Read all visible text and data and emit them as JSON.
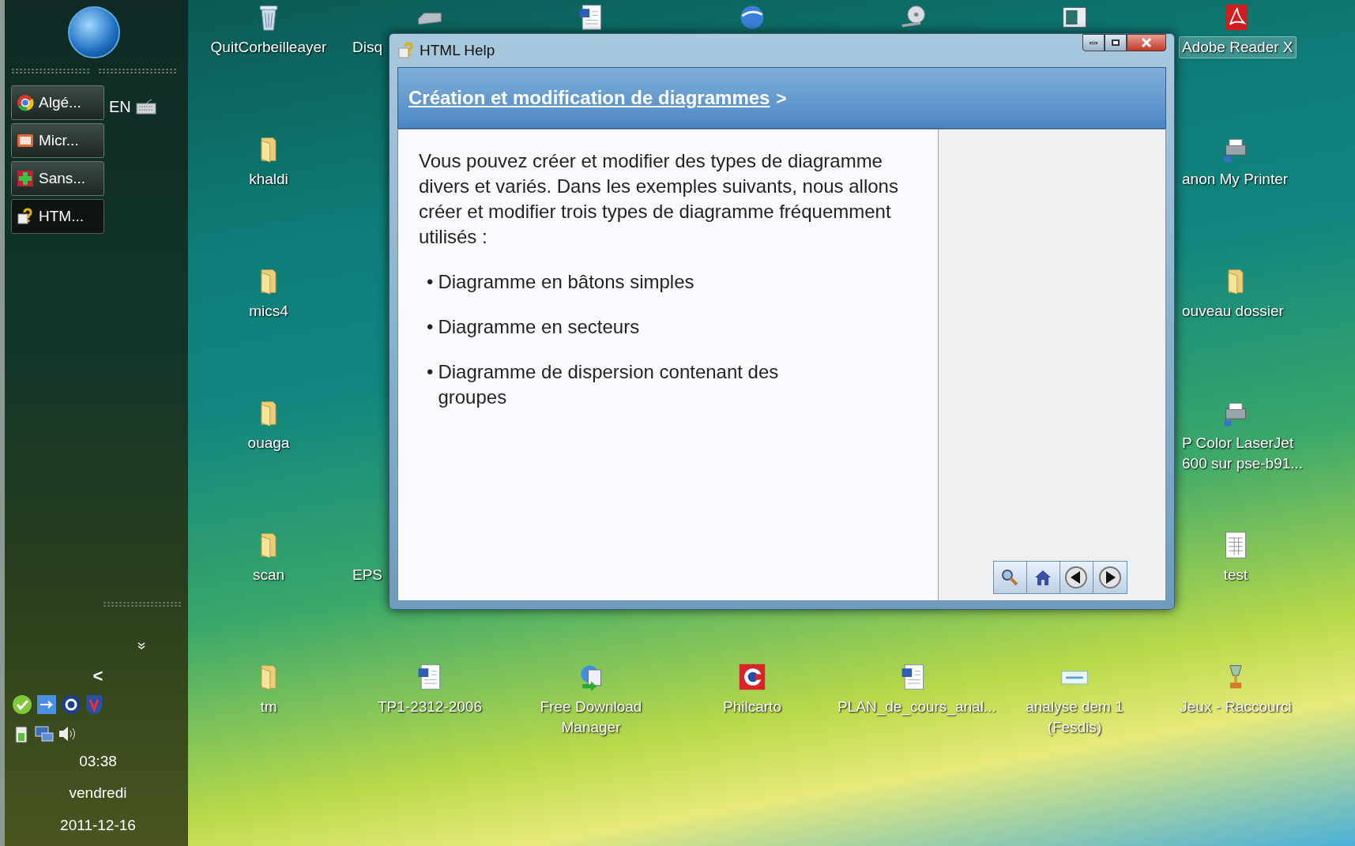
{
  "taskbar": {
    "tasks": [
      {
        "label": "Algé...",
        "kind": "chrome",
        "selected": false
      },
      {
        "label": "Micr...",
        "kind": "slides",
        "selected": false
      },
      {
        "label": "Sans...",
        "kind": "paint",
        "selected": false
      },
      {
        "label": "HTM...",
        "kind": "help",
        "selected": true
      }
    ],
    "language": "EN",
    "tray_arrow": "<",
    "clock": {
      "time": "03:38",
      "day": "vendredi",
      "date": "2011-12-16"
    }
  },
  "desktop_icons": [
    {
      "label": "QuitCorbeilleayer",
      "kind": "recycle",
      "selected": false
    },
    {
      "label": "Disq",
      "kind": "drive",
      "selected": false
    },
    {
      "kind": "doc"
    },
    {
      "kind": "globe"
    },
    {
      "kind": "cd"
    },
    {
      "kind": "window"
    },
    {
      "label": "Adobe Reader X",
      "kind": "pdf",
      "selected": true
    },
    {
      "label": "khaldi",
      "kind": "folder",
      "selected": false
    },
    {
      "label": "anon My Printer",
      "kind": "printer",
      "selected": false
    },
    {
      "label": "mics4",
      "kind": "folder",
      "selected": false
    },
    {
      "label": "ouveau dossier",
      "kind": "folder",
      "selected": false
    },
    {
      "label": "ouaga",
      "kind": "folder",
      "selected": false
    },
    {
      "label": "P Color LaserJet 600 sur pse-b91...",
      "kind": "printer",
      "selected": false
    },
    {
      "label": "scan",
      "kind": "folder",
      "selected": false
    },
    {
      "label": "EPS",
      "kind": "none",
      "selected": false
    },
    {
      "label": "test",
      "kind": "sheet",
      "selected": false
    },
    {
      "label": "tm",
      "kind": "folder",
      "selected": false
    },
    {
      "label": "TP1-2312-2006",
      "kind": "doc",
      "selected": false
    },
    {
      "label": "Free Download Manager",
      "kind": "download",
      "selected": false
    },
    {
      "label": "Philcarto",
      "kind": "philcarto",
      "selected": false
    },
    {
      "label": "PLAN_de_cours_anal...",
      "kind": "doc",
      "selected": false
    },
    {
      "label": "analyse dem 1 (Fesdis)",
      "kind": "banner",
      "selected": false
    },
    {
      "label": "Jeux - Raccourci",
      "kind": "trophy",
      "selected": false
    }
  ],
  "help_window": {
    "title": "HTML Help",
    "header_link": "Création et modification de diagrammes",
    "header_suffix": ">",
    "intro": "Vous pouvez créer et modifier des types de diagramme divers et variés. Dans les exemples suivants, nous allons créer et modifier trois types de diagramme fréquemment utilisés :",
    "bullet": "•",
    "bullets": [
      "Diagramme en bâtons simples",
      "Diagramme en secteurs",
      "Diagramme de dispersion contenant des groupes"
    ]
  }
}
